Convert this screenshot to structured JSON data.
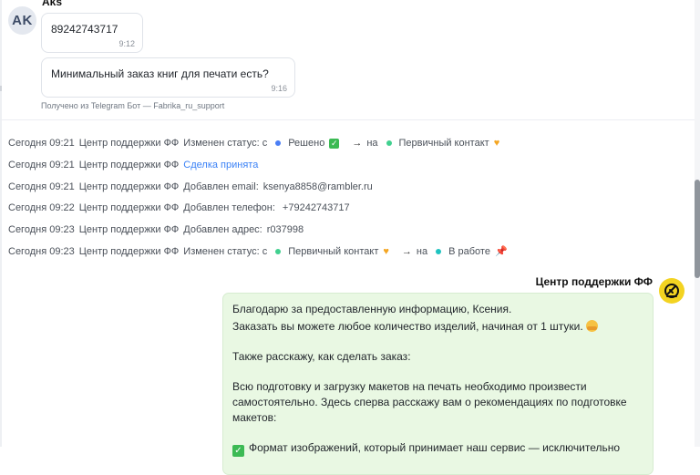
{
  "client": {
    "initials": "AK",
    "name": "Aks",
    "messages": [
      {
        "text": "89242743717",
        "time": "9:12"
      },
      {
        "text": "Минимальный заказ книг для печати есть?",
        "time": "9:16"
      }
    ],
    "source_note": "Получено из Telegram Бот — Fabrika_ru_support"
  },
  "log": [
    {
      "date": "Сегодня 09:21",
      "actor": "Центр поддержки ФФ",
      "action": "Изменен статус: с",
      "from": "Решено",
      "to_word": "на",
      "to": "Первичный контакт"
    },
    {
      "date": "Сегодня 09:21",
      "actor": "Центр поддержки ФФ",
      "action": "Сделка принята"
    },
    {
      "date": "Сегодня 09:21",
      "actor": "Центр поддержки ФФ",
      "action": "Добавлен email:",
      "value": "ksenya8858@rambler.ru"
    },
    {
      "date": "Сегодня 09:22",
      "actor": "Центр поддержки ФФ",
      "action": "Добавлен телефон:",
      "value": "+79242743717"
    },
    {
      "date": "Сегодня 09:23",
      "actor": "Центр поддержки ФФ",
      "action": "Добавлен адрес:",
      "value": "r037998"
    },
    {
      "date": "Сегодня 09:23",
      "actor": "Центр поддержки ФФ",
      "action": "Изменен статус: с",
      "from": "Первичный контакт",
      "to_word": "на",
      "to": "В работе"
    }
  ],
  "agent": {
    "name": "Центр поддержки ФФ",
    "reply_lines": [
      "Благодарю за предоставленную информацию, Ксения.",
      "Заказать вы можете любое количество изделий, начиная от 1 штуки.",
      "Также расскажу, как сделать заказ:",
      "Всю подготовку и загрузку макетов на печать необходимо произвести",
      "самостоятельно. Здесь сперва расскажу вам о рекомендациях по подготовке",
      "макетов:",
      "Формат изображений, который принимает наш сервис — исключительно"
    ]
  },
  "colors": {
    "status_solved": "#4a7ef5",
    "status_primary": "#41d08f",
    "status_work": "#1fc3c0",
    "reply_bg": "#e9f8e3",
    "link": "#3b82f6"
  },
  "icons": {
    "check": "check-emoji-icon",
    "heart": "yellow-heart-icon",
    "pin": "pushpin-icon",
    "hug": "hugging-face-icon"
  }
}
